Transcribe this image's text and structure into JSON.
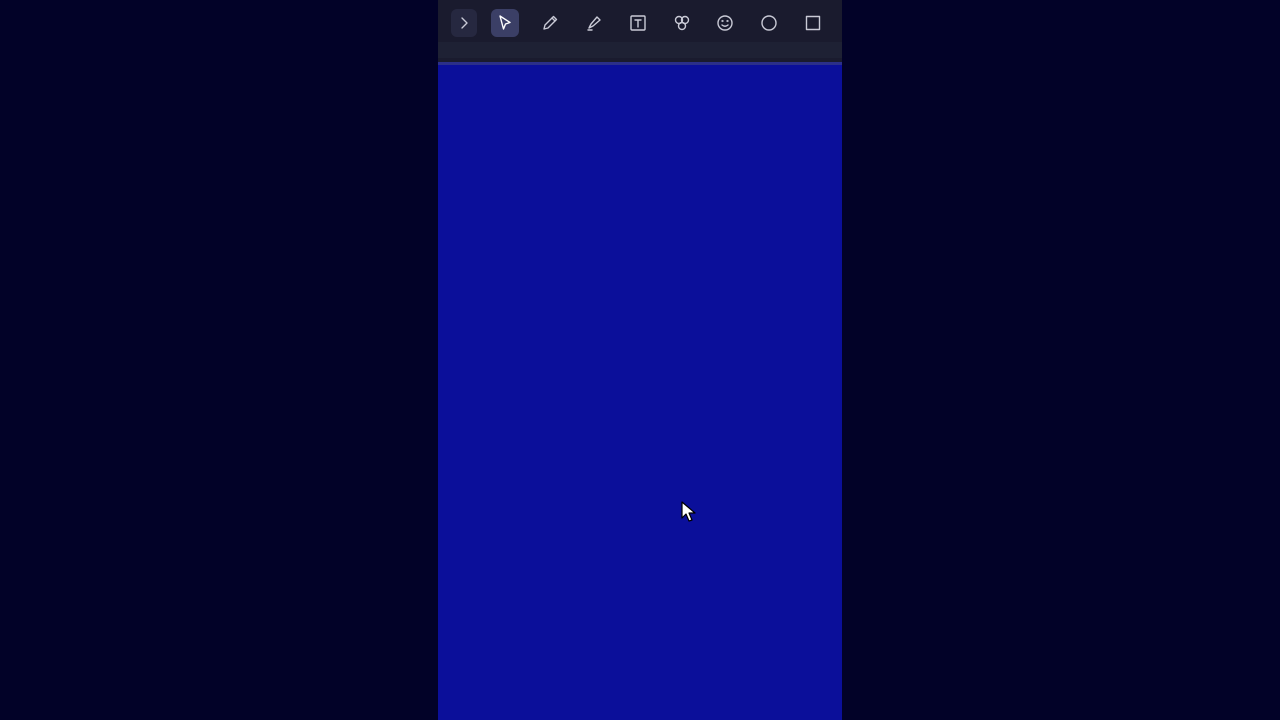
{
  "colors": {
    "backdrop": "#020228",
    "canvas": "#0b0f9a",
    "toolbar_bg": "#1a1b2e",
    "active_tool_bg": "#3b3f66",
    "icon_stroke": "#c9cad6"
  },
  "toolbar": {
    "tools": [
      {
        "id": "expand",
        "icon": "chevron-right-icon",
        "active": false
      },
      {
        "id": "select",
        "icon": "pointer-arrow-icon",
        "active": true
      },
      {
        "id": "pen",
        "icon": "pencil-icon",
        "active": false
      },
      {
        "id": "highlighter",
        "icon": "highlighter-icon",
        "active": false
      },
      {
        "id": "text",
        "icon": "text-box-icon",
        "active": false
      },
      {
        "id": "stickers",
        "icon": "stickers-icon",
        "active": false
      },
      {
        "id": "emoji",
        "icon": "smiley-icon",
        "active": false
      },
      {
        "id": "circle",
        "icon": "circle-icon",
        "active": false
      },
      {
        "id": "rectangle",
        "icon": "square-icon",
        "active": false
      }
    ]
  },
  "cursor": {
    "icon": "mouse-pointer-icon"
  }
}
